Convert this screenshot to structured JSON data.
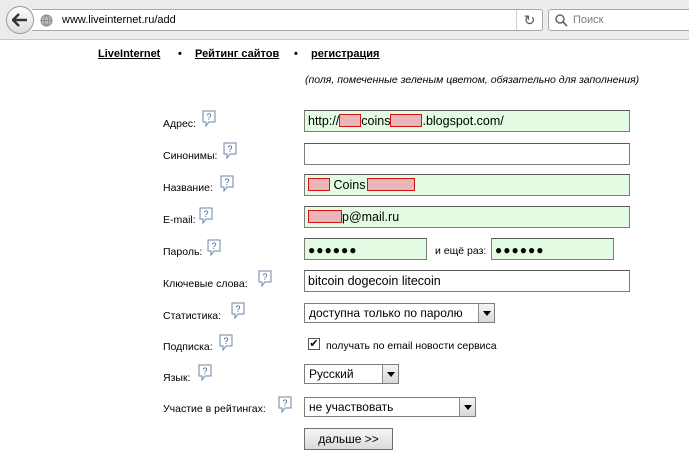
{
  "browser": {
    "url": "www.liveinternet.ru/add",
    "search_placeholder": "Поиск"
  },
  "nav": {
    "items": [
      "LiveInternet",
      "Рейтинг сайтов",
      "регистрация"
    ],
    "separator": "•"
  },
  "note": "(поля, помеченные зеленым цветом, обязательно для заполнения)",
  "form": {
    "address": {
      "label": "Адрес:",
      "value_prefix": "http://",
      "value_mid": "coins",
      "value_suffix": ".blogspot.com/"
    },
    "synonyms": {
      "label": "Синонимы:",
      "value": ""
    },
    "name": {
      "label": "Название:",
      "value_mid": "Coins"
    },
    "email": {
      "label": "E-mail:",
      "value_suffix": "p@mail.ru"
    },
    "password": {
      "label": "Пароль:",
      "value": "●●●●●●",
      "repeat_label": "и ещё раз:",
      "repeat_value": "●●●●●●"
    },
    "keywords": {
      "label": "Ключевые слова:",
      "value": "bitcoin dogecoin litecoin"
    },
    "stats": {
      "label": "Статистика:",
      "value": "доступна только по паролю"
    },
    "subscription": {
      "label": "Подписка:",
      "checkbox_label": "получать по email новости сервиса",
      "checked": true
    },
    "language": {
      "label": "Язык:",
      "value": "Русский"
    },
    "ratings": {
      "label": "Участие в рейтингах:",
      "value": "не участвовать"
    },
    "submit": "дальше >>"
  },
  "colors": {
    "required_field": "#e3fbe3",
    "redaction": "#d21414"
  },
  "help_icon": "question-help-icon"
}
